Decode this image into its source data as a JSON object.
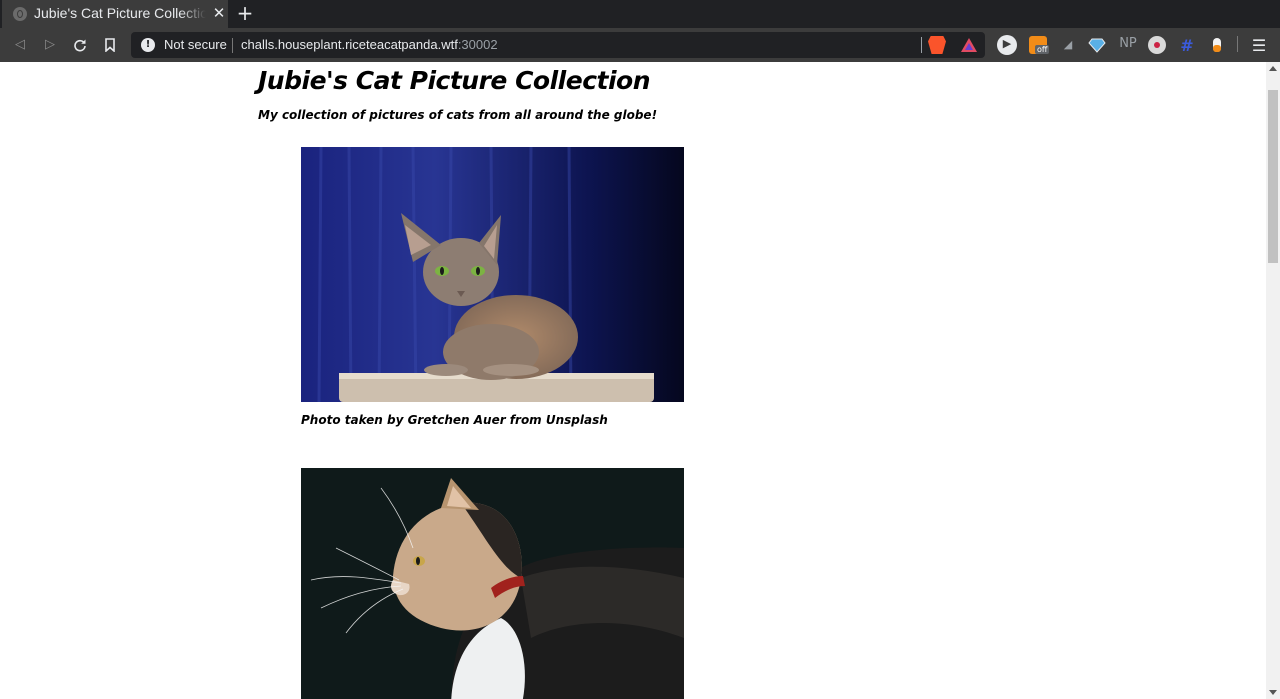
{
  "browser": {
    "tab": {
      "title": "Jubie's Cat Picture Collection"
    },
    "address_bar": {
      "security_label": "Not secure",
      "host": "challs.houseplant.riceteacatpanda.wtf",
      "port": ":30002"
    },
    "extension_labels": {
      "np": "NP",
      "off": "off"
    }
  },
  "page": {
    "title": "Jubie's Cat Picture Collection",
    "subtitle": "My collection of pictures of cats from all around the globe!",
    "photos": [
      {
        "caption": "Photo taken by Gretchen Auer from Unsplash",
        "subject": "grey russian blue cat on a cat tree in front of a blue curtain"
      },
      {
        "caption": "",
        "subject": "calico cat in profile on a dark background"
      }
    ]
  }
}
